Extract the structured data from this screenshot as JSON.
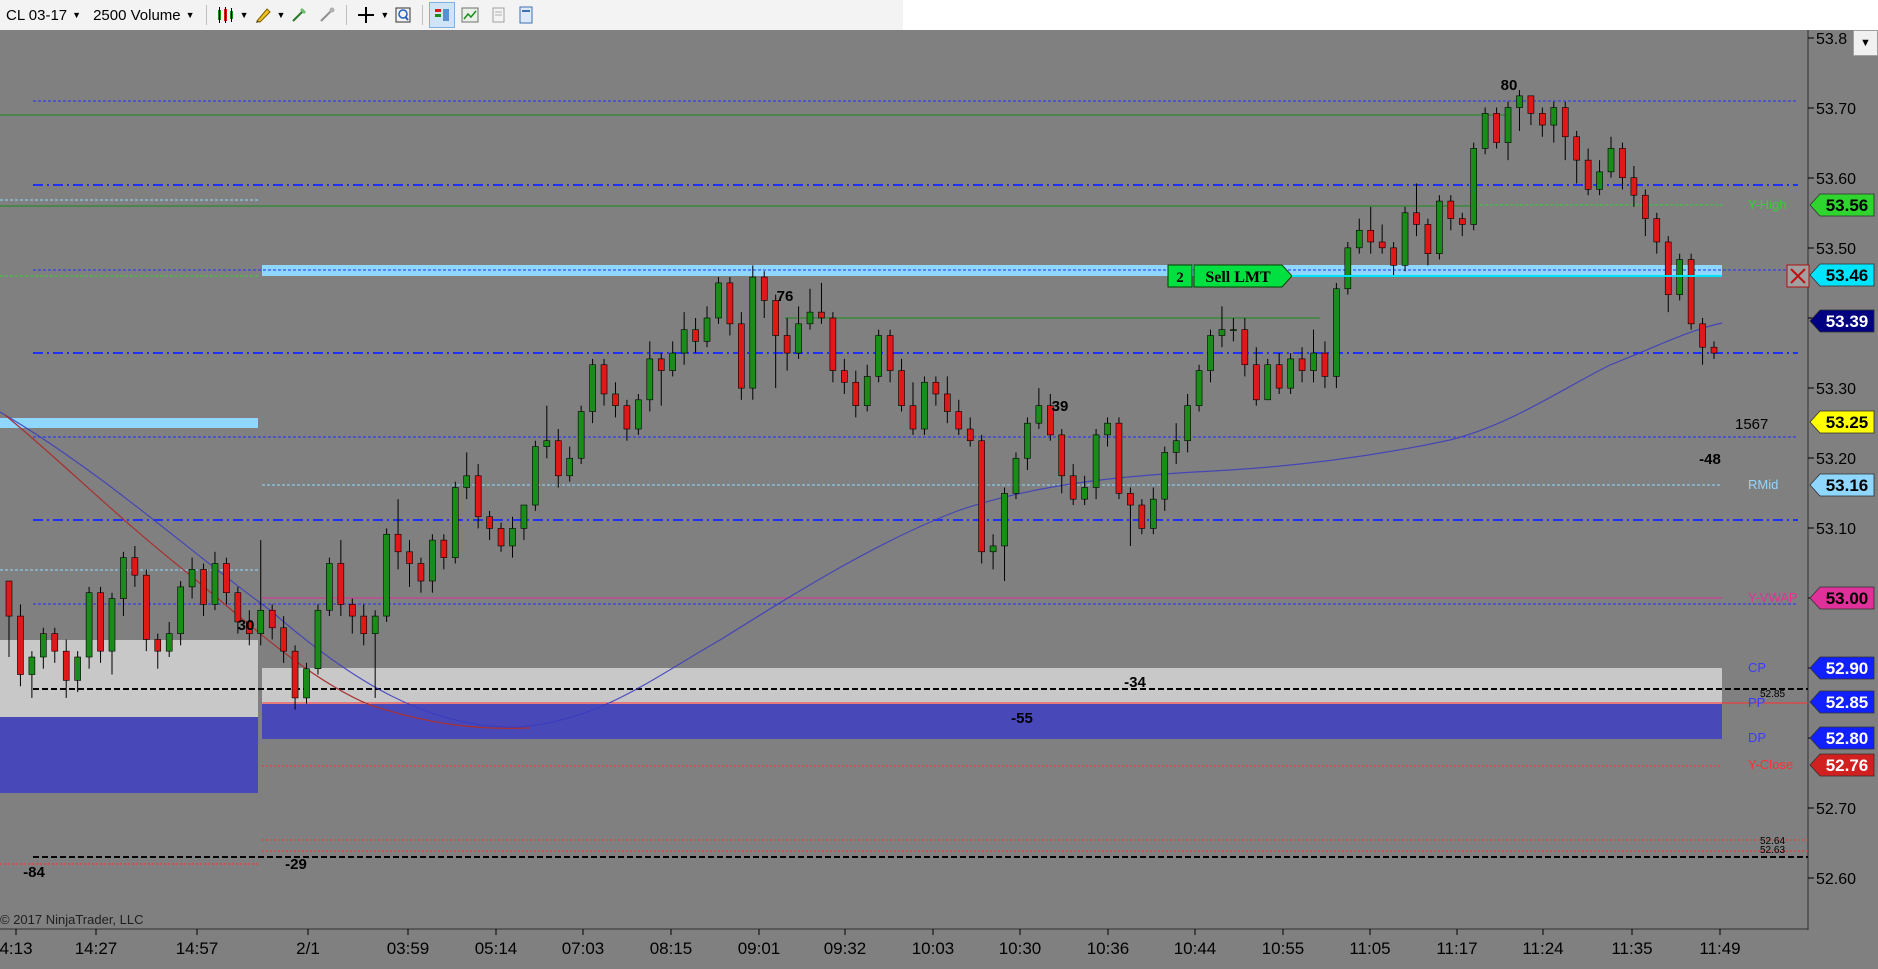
{
  "toolbar": {
    "instrument": "CL 03-17",
    "bar_type": "2500 Volume",
    "icons": [
      "candlestick-icon",
      "pencil-icon",
      "drawing-tools-icon",
      "magic-wand-icon",
      "crosshair-icon",
      "zoom-icon",
      "chart-trader-icon",
      "chart-style-icon",
      "data-box-icon",
      "properties-icon"
    ]
  },
  "copyright": "© 2017 NinjaTrader, LLC",
  "colors": {
    "background": "#808080",
    "up_candle": "#1a8c1a",
    "down_candle": "#e01818",
    "sell_order": "#00e040",
    "price_marker": "#00e5ff",
    "last_price": "#ffff00",
    "vwap": "#e0309a"
  },
  "chart_data": {
    "type": "candlestick",
    "ylim": [
      52.55,
      53.82
    ],
    "y_ticks": [
      "53.8",
      "53.70",
      "53.60",
      "53.50",
      "53.40",
      "53.30",
      "53.20",
      "53.10",
      "53.00",
      "52.90",
      "52.80",
      "52.70",
      "52.60"
    ],
    "x_ticks": [
      "4:13",
      "14:27",
      "14:57",
      "2/1",
      "03:59",
      "05:14",
      "07:03",
      "08:15",
      "09:01",
      "09:32",
      "10:03",
      "10:30",
      "10:36",
      "10:44",
      "10:55",
      "11:05",
      "11:17",
      "11:24",
      "11:35",
      "11:49"
    ],
    "candles": [
      [
        52.86,
        52.8,
        52.86,
        52.73
      ],
      [
        52.8,
        52.7,
        52.82,
        52.68
      ],
      [
        52.7,
        52.73,
        52.74,
        52.66
      ],
      [
        52.73,
        52.77,
        52.78,
        52.71
      ],
      [
        52.77,
        52.74,
        52.78,
        52.72
      ],
      [
        52.74,
        52.69,
        52.76,
        52.66
      ],
      [
        52.69,
        52.73,
        52.74,
        52.67
      ],
      [
        52.73,
        52.84,
        52.85,
        52.71
      ],
      [
        52.84,
        52.74,
        52.85,
        52.72
      ],
      [
        52.74,
        52.83,
        52.84,
        52.7
      ],
      [
        52.83,
        52.9,
        52.91,
        52.8
      ],
      [
        52.9,
        52.87,
        52.92,
        52.85
      ],
      [
        52.87,
        52.76,
        52.88,
        52.74
      ],
      [
        52.76,
        52.74,
        52.77,
        52.71
      ],
      [
        52.74,
        52.77,
        52.79,
        52.73
      ],
      [
        52.77,
        52.85,
        52.86,
        52.75
      ],
      [
        52.85,
        52.88,
        52.9,
        52.83
      ],
      [
        52.88,
        52.82,
        52.89,
        52.8
      ],
      [
        52.82,
        52.89,
        52.91,
        52.81
      ],
      [
        52.89,
        52.84,
        52.9,
        52.82
      ],
      [
        52.84,
        52.79,
        52.85,
        52.77
      ],
      [
        52.79,
        52.77,
        52.81,
        52.75
      ],
      [
        52.77,
        52.81,
        52.93,
        52.75
      ],
      [
        52.81,
        52.78,
        52.82,
        52.76
      ],
      [
        52.78,
        52.74,
        52.8,
        52.72
      ],
      [
        52.74,
        52.66,
        52.75,
        52.64
      ],
      [
        52.66,
        52.71,
        52.72,
        52.65
      ],
      [
        52.71,
        52.81,
        52.82,
        52.7
      ],
      [
        52.81,
        52.89,
        52.9,
        52.8
      ],
      [
        52.89,
        52.82,
        52.93,
        52.8
      ],
      [
        52.82,
        52.8,
        52.83,
        52.77
      ],
      [
        52.8,
        52.77,
        52.82,
        52.75
      ],
      [
        52.77,
        52.8,
        52.81,
        52.66
      ],
      [
        52.8,
        52.94,
        52.95,
        52.79
      ],
      [
        52.94,
        52.91,
        53.0,
        52.88
      ],
      [
        52.91,
        52.89,
        52.93,
        52.85
      ],
      [
        52.89,
        52.86,
        52.9,
        52.84
      ],
      [
        52.86,
        52.93,
        52.94,
        52.84
      ],
      [
        52.93,
        52.9,
        52.94,
        52.88
      ],
      [
        52.9,
        53.02,
        53.03,
        52.89
      ],
      [
        53.02,
        53.04,
        53.08,
        53.0
      ],
      [
        53.04,
        52.97,
        53.06,
        52.95
      ],
      [
        52.97,
        52.95,
        52.98,
        52.93
      ],
      [
        52.95,
        52.92,
        52.96,
        52.91
      ],
      [
        52.92,
        52.95,
        52.97,
        52.9
      ],
      [
        52.95,
        52.99,
        52.99,
        52.93
      ],
      [
        52.99,
        53.09,
        53.1,
        52.98
      ],
      [
        53.09,
        53.1,
        53.16,
        53.07
      ],
      [
        53.1,
        53.04,
        53.12,
        53.02
      ],
      [
        53.04,
        53.07,
        53.09,
        53.03
      ],
      [
        53.07,
        53.15,
        53.16,
        53.06
      ],
      [
        53.15,
        53.23,
        53.24,
        53.13
      ],
      [
        53.23,
        53.18,
        53.24,
        53.16
      ],
      [
        53.18,
        53.16,
        53.2,
        53.14
      ],
      [
        53.16,
        53.12,
        53.17,
        53.1
      ],
      [
        53.12,
        53.17,
        53.18,
        53.11
      ],
      [
        53.17,
        53.24,
        53.27,
        53.15
      ],
      [
        53.24,
        53.22,
        53.25,
        53.16
      ],
      [
        53.22,
        53.25,
        53.27,
        53.21
      ],
      [
        53.25,
        53.29,
        53.32,
        53.23
      ],
      [
        53.29,
        53.27,
        53.31,
        53.25
      ],
      [
        53.27,
        53.31,
        53.33,
        53.26
      ],
      [
        53.31,
        53.37,
        53.38,
        53.3
      ],
      [
        53.37,
        53.3,
        53.38,
        53.28
      ],
      [
        53.3,
        53.19,
        53.32,
        53.17
      ],
      [
        53.19,
        53.38,
        53.4,
        53.17
      ],
      [
        53.38,
        53.34,
        53.39,
        53.31
      ],
      [
        53.34,
        53.28,
        53.35,
        53.19
      ],
      [
        53.28,
        53.25,
        53.31,
        53.22
      ],
      [
        53.25,
        53.3,
        53.33,
        53.24
      ],
      [
        53.3,
        53.32,
        53.36,
        53.29
      ],
      [
        53.32,
        53.31,
        53.37,
        53.3
      ],
      [
        53.31,
        53.22,
        53.32,
        53.2
      ],
      [
        53.22,
        53.2,
        53.24,
        53.18
      ],
      [
        53.2,
        53.16,
        53.22,
        53.14
      ],
      [
        53.16,
        53.21,
        53.23,
        53.15
      ],
      [
        53.21,
        53.28,
        53.29,
        53.2
      ],
      [
        53.28,
        53.22,
        53.29,
        53.2
      ],
      [
        53.22,
        53.16,
        53.24,
        53.15
      ],
      [
        53.16,
        53.12,
        53.2,
        53.11
      ],
      [
        53.12,
        53.2,
        53.21,
        53.11
      ],
      [
        53.2,
        53.18,
        53.21,
        53.16
      ],
      [
        53.18,
        53.15,
        53.21,
        53.13
      ],
      [
        53.15,
        53.12,
        53.17,
        53.11
      ],
      [
        53.12,
        53.1,
        53.14,
        53.09
      ],
      [
        53.1,
        52.91,
        53.11,
        52.89
      ],
      [
        52.91,
        52.92,
        52.94,
        52.88
      ],
      [
        52.92,
        53.01,
        53.02,
        52.86
      ],
      [
        53.01,
        53.07,
        53.08,
        53.0
      ],
      [
        53.07,
        53.13,
        53.14,
        53.05
      ],
      [
        53.13,
        53.16,
        53.19,
        53.12
      ],
      [
        53.16,
        53.11,
        53.18,
        53.1
      ],
      [
        53.11,
        53.04,
        53.12,
        53.01
      ],
      [
        53.04,
        53.0,
        53.06,
        52.99
      ],
      [
        53.0,
        53.02,
        53.04,
        52.99
      ],
      [
        53.02,
        53.11,
        53.12,
        53.0
      ],
      [
        53.11,
        53.13,
        53.14,
        53.09
      ],
      [
        53.13,
        53.01,
        53.14,
        53.0
      ],
      [
        53.01,
        52.99,
        53.02,
        52.92
      ],
      [
        52.99,
        52.95,
        53.0,
        52.94
      ],
      [
        52.95,
        53.0,
        53.02,
        52.94
      ],
      [
        53.0,
        53.08,
        53.09,
        52.98
      ],
      [
        53.08,
        53.1,
        53.13,
        53.06
      ],
      [
        53.1,
        53.16,
        53.18,
        53.08
      ],
      [
        53.16,
        53.22,
        53.23,
        53.15
      ],
      [
        53.22,
        53.28,
        53.29,
        53.2
      ],
      [
        53.28,
        53.29,
        53.33,
        53.26
      ],
      [
        53.29,
        53.29,
        53.31,
        53.27
      ],
      [
        53.29,
        53.23,
        53.31,
        53.21
      ],
      [
        53.23,
        53.17,
        53.26,
        53.16
      ],
      [
        53.17,
        53.23,
        53.24,
        53.17
      ],
      [
        53.23,
        53.19,
        53.25,
        53.18
      ],
      [
        53.19,
        53.24,
        53.25,
        53.18
      ],
      [
        53.24,
        53.22,
        53.26,
        53.2
      ],
      [
        53.22,
        53.25,
        53.29,
        53.2
      ],
      [
        53.25,
        53.21,
        53.27,
        53.19
      ],
      [
        53.21,
        53.36,
        53.37,
        53.19
      ],
      [
        53.36,
        53.43,
        53.44,
        53.35
      ],
      [
        53.43,
        53.46,
        53.48,
        53.42
      ],
      [
        53.46,
        53.44,
        53.5,
        53.42
      ],
      [
        53.44,
        53.43,
        53.47,
        53.42
      ],
      [
        53.43,
        53.4,
        53.44,
        53.38
      ],
      [
        53.4,
        53.49,
        53.5,
        53.39
      ],
      [
        53.49,
        53.47,
        53.54,
        53.45
      ],
      [
        53.47,
        53.42,
        53.48,
        53.4
      ],
      [
        53.42,
        53.51,
        53.52,
        53.41
      ],
      [
        53.51,
        53.48,
        53.52,
        53.46
      ],
      [
        53.48,
        53.47,
        53.49,
        53.45
      ],
      [
        53.47,
        53.6,
        53.61,
        53.46
      ],
      [
        53.6,
        53.66,
        53.67,
        53.59
      ],
      [
        53.66,
        53.61,
        53.67,
        53.6
      ],
      [
        53.61,
        53.67,
        53.68,
        53.58
      ],
      [
        53.67,
        53.69,
        53.7,
        53.63
      ],
      [
        53.69,
        53.66,
        53.69,
        53.64
      ],
      [
        53.66,
        53.64,
        53.67,
        53.62
      ],
      [
        53.64,
        53.67,
        53.68,
        53.61
      ],
      [
        53.67,
        53.62,
        53.68,
        53.58
      ],
      [
        53.62,
        53.58,
        53.63,
        53.54
      ],
      [
        53.58,
        53.53,
        53.6,
        53.52
      ],
      [
        53.53,
        53.56,
        53.58,
        53.52
      ],
      [
        53.56,
        53.6,
        53.62,
        53.55
      ],
      [
        53.6,
        53.55,
        53.61,
        53.53
      ],
      [
        53.55,
        53.52,
        53.57,
        53.5
      ],
      [
        53.52,
        53.48,
        53.53,
        53.45
      ],
      [
        53.48,
        53.44,
        53.49,
        53.42
      ],
      [
        53.44,
        53.35,
        53.45,
        53.32
      ],
      [
        53.35,
        53.41,
        53.42,
        53.34
      ],
      [
        53.41,
        53.3,
        53.42,
        53.29
      ],
      [
        53.3,
        53.26,
        53.31,
        53.23
      ],
      [
        53.26,
        53.25,
        53.27,
        53.24
      ]
    ],
    "horizontal_levels": [
      {
        "label": "Y-High",
        "price": 53.56,
        "color": "#2fd42f"
      },
      {
        "label": "RMid",
        "price": 53.16,
        "color": "#8fd7ff"
      },
      {
        "label": "Y-VWAP",
        "price": 53.0,
        "color": "#e0309a"
      },
      {
        "label": "CP",
        "price": 52.9,
        "color": "#3a3aff"
      },
      {
        "label": "PP",
        "price": 52.85,
        "color": "#3a3aff"
      },
      {
        "label": "DP",
        "price": 52.8,
        "color": "#3a3aff"
      },
      {
        "label": "Y-Close",
        "price": 52.76,
        "color": "#ff3030"
      }
    ],
    "price_markers": [
      {
        "label": "53.56",
        "bg": "#2fd42f",
        "fg": "#000000"
      },
      {
        "label": "53.46",
        "bg": "#00e5ff",
        "fg": "#000000"
      },
      {
        "label": "53.39",
        "bg": "#000080",
        "fg": "#ffffff"
      },
      {
        "label": "53.25",
        "bg": "#ffff00",
        "fg": "#000000"
      },
      {
        "label": "53.16",
        "bg": "#8fd7ff",
        "fg": "#000000"
      },
      {
        "label": "53.00",
        "bg": "#e0309a",
        "fg": "#000000"
      },
      {
        "label": "52.90",
        "bg": "#1020ff",
        "fg": "#ffffff"
      },
      {
        "label": "52.85",
        "bg": "#1020ff",
        "fg": "#ffffff"
      },
      {
        "label": "52.80",
        "bg": "#1020ff",
        "fg": "#ffffff"
      },
      {
        "label": "52.76",
        "bg": "#d02020",
        "fg": "#ffffff"
      }
    ],
    "small_labels": [
      "52.85",
      "52.64",
      "52.63"
    ],
    "swing_labels": [
      "30",
      "-84",
      "-29",
      "76",
      "39",
      "-55",
      "-34",
      "80",
      "-48"
    ],
    "order": {
      "quantity": "2",
      "label": "Sell LMT",
      "price": 53.46
    },
    "volume_counter": "1567"
  }
}
